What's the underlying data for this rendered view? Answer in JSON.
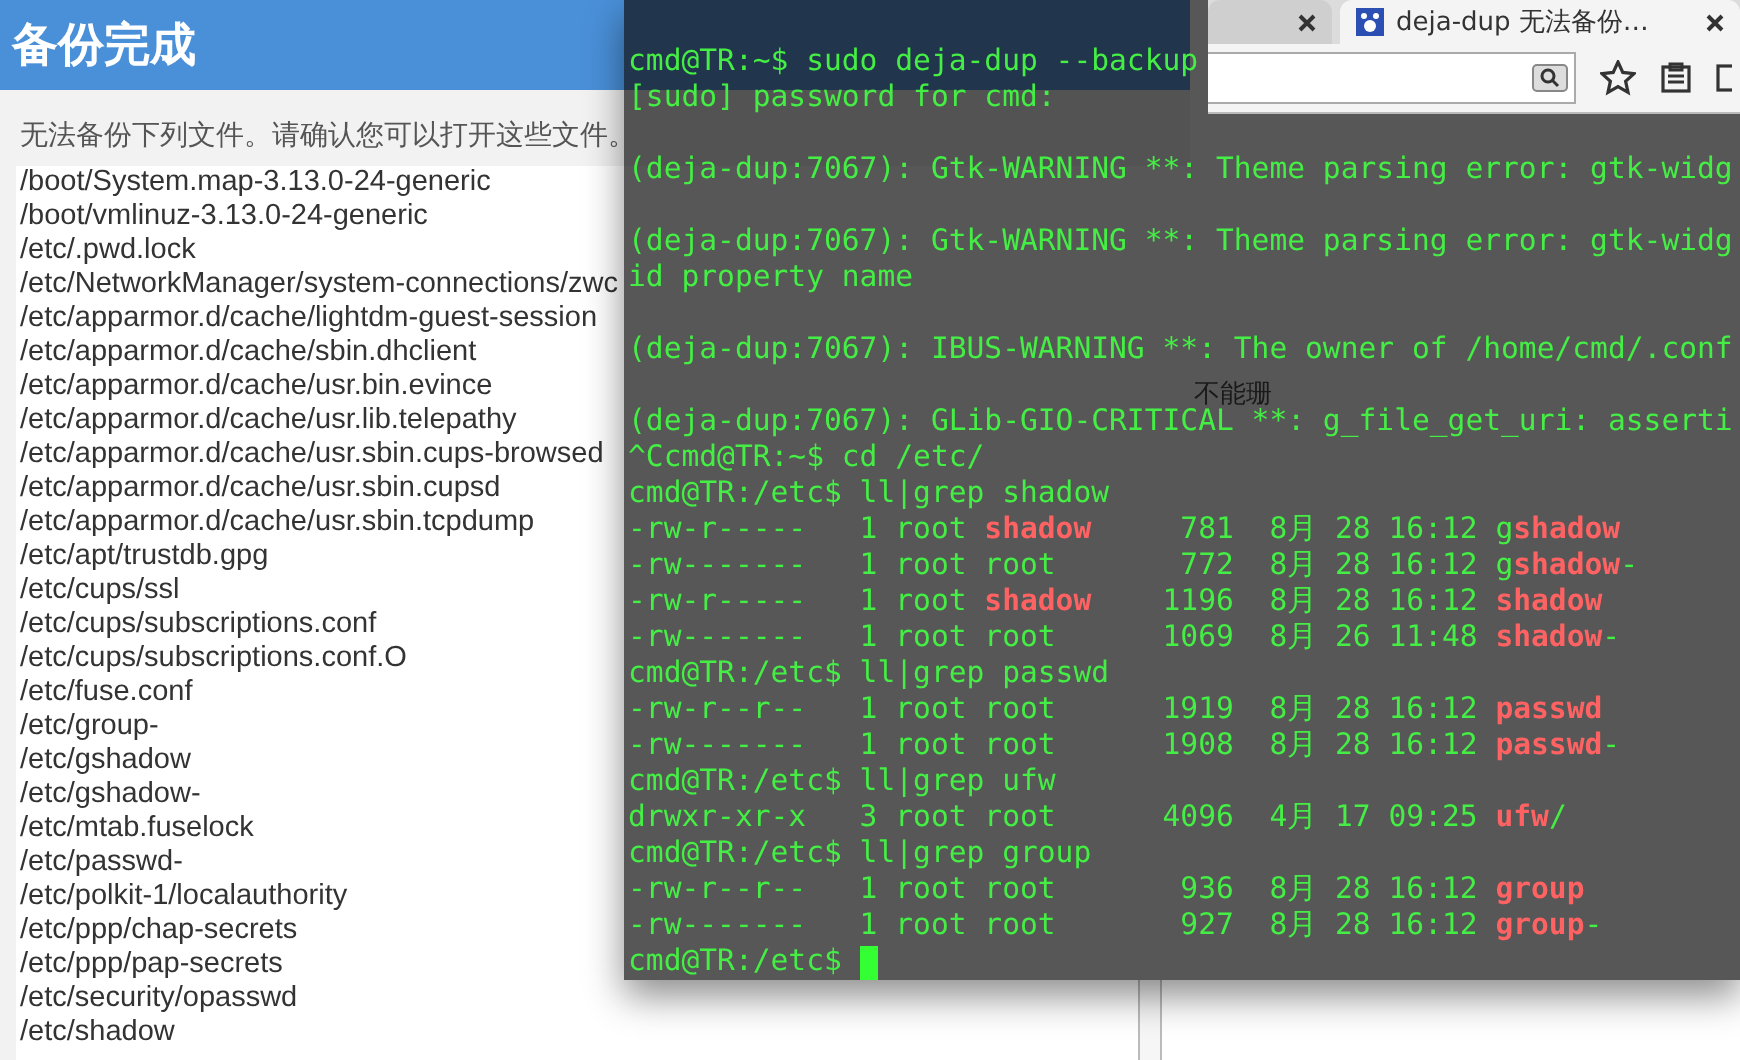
{
  "dialog": {
    "title": "备份完成",
    "message": "无法备份下列文件。请确认您可以打开这些文件。",
    "files": [
      "/boot/System.map-3.13.0-24-generic",
      "/boot/vmlinuz-3.13.0-24-generic",
      "/etc/.pwd.lock",
      "/etc/NetworkManager/system-connections/zwc",
      "/etc/apparmor.d/cache/lightdm-guest-session",
      "/etc/apparmor.d/cache/sbin.dhclient",
      "/etc/apparmor.d/cache/usr.bin.evince",
      "/etc/apparmor.d/cache/usr.lib.telepathy",
      "/etc/apparmor.d/cache/usr.sbin.cups-browsed",
      "/etc/apparmor.d/cache/usr.sbin.cupsd",
      "/etc/apparmor.d/cache/usr.sbin.tcpdump",
      "/etc/apt/trustdb.gpg",
      "/etc/cups/ssl",
      "/etc/cups/subscriptions.conf",
      "/etc/cups/subscriptions.conf.O",
      "/etc/fuse.conf",
      "/etc/group-",
      "/etc/gshadow",
      "/etc/gshadow-",
      "/etc/mtab.fuselock",
      "/etc/passwd-",
      "/etc/polkit-1/localauthority",
      "/etc/ppp/chap-secrets",
      "/etc/ppp/pap-secrets",
      "/etc/security/opasswd",
      "/etc/shadow"
    ]
  },
  "browser": {
    "tabs": [
      {
        "selected": false
      },
      {
        "title": "deja-dup 无法备份…",
        "selected": true
      }
    ],
    "page_texts": [
      "不能珊"
    ]
  },
  "terminal": {
    "cursor_visible": true,
    "lines": [
      {
        "kind": "text",
        "segments": [
          {
            "kind": "text",
            "text": "cmd@TR:~$ sudo deja-dup --backup"
          }
        ]
      },
      {
        "kind": "text",
        "segments": [
          {
            "kind": "text",
            "text": "[sudo] password for cmd:"
          }
        ]
      },
      {
        "kind": "blank"
      },
      {
        "kind": "text",
        "segments": [
          {
            "kind": "text",
            "text": "(deja-dup:7067): Gtk-WARNING **: Theme parsing error: gtk-widg"
          }
        ]
      },
      {
        "kind": "blank"
      },
      {
        "kind": "text",
        "segments": [
          {
            "kind": "text",
            "text": "(deja-dup:7067): Gtk-WARNING **: Theme parsing error: gtk-widg"
          }
        ]
      },
      {
        "kind": "text",
        "segments": [
          {
            "kind": "text",
            "text": "id property name"
          }
        ]
      },
      {
        "kind": "blank"
      },
      {
        "kind": "text",
        "segments": [
          {
            "kind": "text",
            "text": "(deja-dup:7067): IBUS-WARNING **: The owner of /home/cmd/.conf"
          }
        ]
      },
      {
        "kind": "blank"
      },
      {
        "kind": "text",
        "segments": [
          {
            "kind": "text",
            "text": "(deja-dup:7067): GLib-GIO-CRITICAL **: g_file_get_uri: asserti"
          }
        ]
      },
      {
        "kind": "text",
        "segments": [
          {
            "kind": "text",
            "text": "^Ccmd@TR:~$ cd /etc/"
          }
        ]
      },
      {
        "kind": "text",
        "segments": [
          {
            "kind": "text",
            "text": "cmd@TR:/etc$ ll|grep shadow"
          }
        ]
      },
      {
        "kind": "text",
        "segments": [
          {
            "kind": "text",
            "text": "-rw-r-----   1 root "
          },
          {
            "kind": "match",
            "text": "shadow"
          },
          {
            "kind": "text",
            "text": "     781  8月 28 16:12 g"
          },
          {
            "kind": "match",
            "text": "shadow"
          }
        ]
      },
      {
        "kind": "text",
        "segments": [
          {
            "kind": "text",
            "text": "-rw-------   1 root root       772  8月 28 16:12 g"
          },
          {
            "kind": "match",
            "text": "shadow"
          },
          {
            "kind": "text",
            "text": "-"
          }
        ]
      },
      {
        "kind": "text",
        "segments": [
          {
            "kind": "text",
            "text": "-rw-r-----   1 root "
          },
          {
            "kind": "match",
            "text": "shadow"
          },
          {
            "kind": "text",
            "text": "    1196  8月 28 16:12 "
          },
          {
            "kind": "match",
            "text": "shadow"
          }
        ]
      },
      {
        "kind": "text",
        "segments": [
          {
            "kind": "text",
            "text": "-rw-------   1 root root      1069  8月 26 11:48 "
          },
          {
            "kind": "match",
            "text": "shadow"
          },
          {
            "kind": "text",
            "text": "-"
          }
        ]
      },
      {
        "kind": "text",
        "segments": [
          {
            "kind": "text",
            "text": "cmd@TR:/etc$ ll|grep passwd"
          }
        ]
      },
      {
        "kind": "text",
        "segments": [
          {
            "kind": "text",
            "text": "-rw-r--r--   1 root root      1919  8月 28 16:12 "
          },
          {
            "kind": "match",
            "text": "passwd"
          }
        ]
      },
      {
        "kind": "text",
        "segments": [
          {
            "kind": "text",
            "text": "-rw-------   1 root root      1908  8月 28 16:12 "
          },
          {
            "kind": "match",
            "text": "passwd"
          },
          {
            "kind": "text",
            "text": "-"
          }
        ]
      },
      {
        "kind": "text",
        "segments": [
          {
            "kind": "text",
            "text": "cmd@TR:/etc$ ll|grep ufw"
          }
        ]
      },
      {
        "kind": "text",
        "segments": [
          {
            "kind": "text",
            "text": "drwxr-xr-x   3 root root      4096  4月 17 09:25 "
          },
          {
            "kind": "match",
            "text": "ufw"
          },
          {
            "kind": "text",
            "text": "/"
          }
        ]
      },
      {
        "kind": "text",
        "segments": [
          {
            "kind": "text",
            "text": "cmd@TR:/etc$ ll|grep group"
          }
        ]
      },
      {
        "kind": "text",
        "segments": [
          {
            "kind": "text",
            "text": "-rw-r--r--   1 root root       936  8月 28 16:12 "
          },
          {
            "kind": "match",
            "text": "group"
          }
        ]
      },
      {
        "kind": "text",
        "segments": [
          {
            "kind": "text",
            "text": "-rw-------   1 root root       927  8月 28 16:12 "
          },
          {
            "kind": "match",
            "text": "group"
          },
          {
            "kind": "text",
            "text": "-"
          }
        ]
      },
      {
        "kind": "text",
        "segments": [
          {
            "kind": "text",
            "text": "cmd@TR:/etc$ "
          }
        ]
      }
    ]
  }
}
